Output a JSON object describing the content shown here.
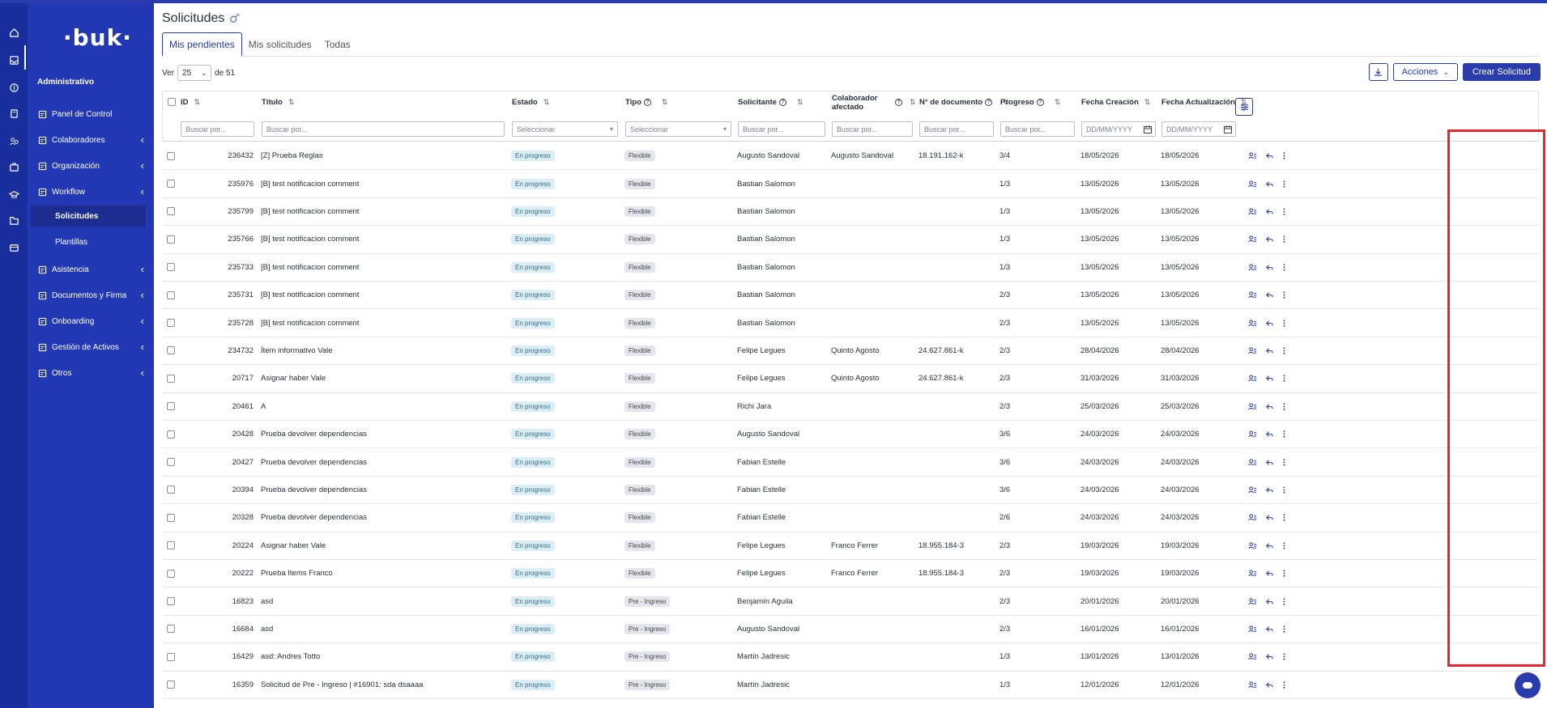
{
  "app": {
    "logo": "·buk·",
    "section_label": "Administrativo",
    "accent_color": "#2a3bab"
  },
  "rail_icons": [
    "home-icon",
    "inbox-icon",
    "money-icon",
    "calculator-icon",
    "people-icon",
    "briefcase-icon",
    "graduation-icon",
    "folder-icon",
    "card-icon"
  ],
  "sidebar": {
    "items": [
      {
        "label": "Panel de Control",
        "icon": "dashboard-icon",
        "chevron": false
      },
      {
        "label": "Colaboradores",
        "icon": "users-icon",
        "chevron": true
      },
      {
        "label": "Organización",
        "icon": "org-icon",
        "chevron": true
      },
      {
        "label": "Workflow",
        "icon": "workflow-icon",
        "chevron": true
      },
      {
        "label": "Asistencia",
        "icon": "calendar-icon",
        "chevron": true
      },
      {
        "label": "Documentos y Firma",
        "icon": "documents-icon",
        "chevron": true
      },
      {
        "label": "Onboarding",
        "icon": "onboarding-icon",
        "chevron": true
      },
      {
        "label": "Gestión de Activos",
        "icon": "assets-icon",
        "chevron": true
      },
      {
        "label": "Otros",
        "icon": "grid-icon",
        "chevron": true
      }
    ],
    "sub_items": [
      {
        "label": "Solicitudes",
        "active": true
      },
      {
        "label": "Plantillas",
        "active": false
      }
    ]
  },
  "page": {
    "title": "Solicitudes",
    "tabs": [
      {
        "label": "Mis pendientes",
        "active": true
      },
      {
        "label": "Mis solicitudes",
        "active": false
      },
      {
        "label": "Todas",
        "active": false
      }
    ],
    "ver_label": "Ver",
    "per_page": "25",
    "of_label": "de 51",
    "actions_label": "Acciones",
    "create_label": "Crear Solicitud"
  },
  "table": {
    "headers": {
      "id": "ID",
      "titulo": "Título",
      "estado": "Estado",
      "tipo": "Tipo",
      "solicitante": "Solicitante",
      "colaborador_1": "Colaborador",
      "colaborador_2": "afectado",
      "documento": "N° de documento",
      "progreso": "Progreso",
      "fecha_creacion": "Fecha Creación",
      "fecha_actualizacion": "Fecha Actualización"
    },
    "filters": {
      "buscar": "Buscar por...",
      "seleccionar": "Seleccionar",
      "fecha": "DD/MM/YYYY"
    },
    "rows": [
      {
        "id": "236432",
        "titulo": "[Z] Prueba Reglas",
        "estado": "En progreso",
        "tipo": "Flexible",
        "solicitante": "Augusto Sandoval",
        "colaborador": "Augusto Sandoval",
        "documento": "18.191.162-k",
        "progreso": "3/4",
        "creacion": "18/05/2026",
        "actualizacion": "18/05/2026"
      },
      {
        "id": "235976",
        "titulo": "[B] test notificacion comment",
        "estado": "En progreso",
        "tipo": "Flexible",
        "solicitante": "Bastian Salomon",
        "colaborador": "",
        "documento": "",
        "progreso": "1/3",
        "creacion": "13/05/2026",
        "actualizacion": "13/05/2026"
      },
      {
        "id": "235799",
        "titulo": "[B] test notificacion comment",
        "estado": "En progreso",
        "tipo": "Flexible",
        "solicitante": "Bastian Salomon",
        "colaborador": "",
        "documento": "",
        "progreso": "1/3",
        "creacion": "13/05/2026",
        "actualizacion": "13/05/2026"
      },
      {
        "id": "235766",
        "titulo": "[B] test notificacion comment",
        "estado": "En progreso",
        "tipo": "Flexible",
        "solicitante": "Bastian Salomon",
        "colaborador": "",
        "documento": "",
        "progreso": "1/3",
        "creacion": "13/05/2026",
        "actualizacion": "13/05/2026"
      },
      {
        "id": "235733",
        "titulo": "[B] test notificacion comment",
        "estado": "En progreso",
        "tipo": "Flexible",
        "solicitante": "Bastian Salomon",
        "colaborador": "",
        "documento": "",
        "progreso": "1/3",
        "creacion": "13/05/2026",
        "actualizacion": "13/05/2026"
      },
      {
        "id": "235731",
        "titulo": "[B] test notificacion comment",
        "estado": "En progreso",
        "tipo": "Flexible",
        "solicitante": "Bastian Salomon",
        "colaborador": "",
        "documento": "",
        "progreso": "2/3",
        "creacion": "13/05/2026",
        "actualizacion": "13/05/2026"
      },
      {
        "id": "235728",
        "titulo": "[B] test notificacion comment",
        "estado": "En progreso",
        "tipo": "Flexible",
        "solicitante": "Bastian Salomon",
        "colaborador": "",
        "documento": "",
        "progreso": "2/3",
        "creacion": "13/05/2026",
        "actualizacion": "13/05/2026"
      },
      {
        "id": "234732",
        "titulo": "Ítem informativo Vale",
        "estado": "En progreso",
        "tipo": "Flexible",
        "solicitante": "Felipe Legues",
        "colaborador": "Quinto Agosto",
        "documento": "24.627.861-k",
        "progreso": "2/3",
        "creacion": "28/04/2026",
        "actualizacion": "28/04/2026"
      },
      {
        "id": "20717",
        "titulo": "Asignar haber Vale",
        "estado": "En progreso",
        "tipo": "Flexible",
        "solicitante": "Felipe Legues",
        "colaborador": "Quinto Agosto",
        "documento": "24.627.861-k",
        "progreso": "2/3",
        "creacion": "31/03/2026",
        "actualizacion": "31/03/2026"
      },
      {
        "id": "20461",
        "titulo": "A",
        "estado": "En progreso",
        "tipo": "Flexible",
        "solicitante": "Richi Jara",
        "colaborador": "",
        "documento": "",
        "progreso": "2/3",
        "creacion": "25/03/2026",
        "actualizacion": "25/03/2026"
      },
      {
        "id": "20428",
        "titulo": "Prueba devolver dependencias",
        "estado": "En progreso",
        "tipo": "Flexible",
        "solicitante": "Augusto Sandoval",
        "colaborador": "",
        "documento": "",
        "progreso": "3/6",
        "creacion": "24/03/2026",
        "actualizacion": "24/03/2026"
      },
      {
        "id": "20427",
        "titulo": "Prueba devolver dependencias",
        "estado": "En progreso",
        "tipo": "Flexible",
        "solicitante": "Fabian Estelle",
        "colaborador": "",
        "documento": "",
        "progreso": "3/6",
        "creacion": "24/03/2026",
        "actualizacion": "24/03/2026"
      },
      {
        "id": "20394",
        "titulo": "Prueba devolver dependencias",
        "estado": "En progreso",
        "tipo": "Flexible",
        "solicitante": "Fabian Estelle",
        "colaborador": "",
        "documento": "",
        "progreso": "3/6",
        "creacion": "24/03/2026",
        "actualizacion": "24/03/2026"
      },
      {
        "id": "20328",
        "titulo": "Prueba devolver dependencias",
        "estado": "En progreso",
        "tipo": "Flexible",
        "solicitante": "Fabian Estelle",
        "colaborador": "",
        "documento": "",
        "progreso": "2/6",
        "creacion": "24/03/2026",
        "actualizacion": "24/03/2026"
      },
      {
        "id": "20224",
        "titulo": "Asignar haber Vale",
        "estado": "En progreso",
        "tipo": "Flexible",
        "solicitante": "Felipe Legues",
        "colaborador": "Franco Ferrer",
        "documento": "18.955.184-3",
        "progreso": "2/3",
        "creacion": "19/03/2026",
        "actualizacion": "19/03/2026"
      },
      {
        "id": "20222",
        "titulo": "Prueba Items Franco",
        "estado": "En progreso",
        "tipo": "Flexible",
        "solicitante": "Felipe Legues",
        "colaborador": "Franco Ferrer",
        "documento": "18.955.184-3",
        "progreso": "2/3",
        "creacion": "19/03/2026",
        "actualizacion": "19/03/2026"
      },
      {
        "id": "16823",
        "titulo": "asd",
        "estado": "En progreso",
        "tipo": "Pre - Ingreso",
        "solicitante": "Benjamín Aguila",
        "colaborador": "",
        "documento": "",
        "progreso": "2/3",
        "creacion": "20/01/2026",
        "actualizacion": "20/01/2026"
      },
      {
        "id": "16684",
        "titulo": "asd",
        "estado": "En progreso",
        "tipo": "Pre - Ingreso",
        "solicitante": "Augusto Sandoval",
        "colaborador": "",
        "documento": "",
        "progreso": "2/3",
        "creacion": "16/01/2026",
        "actualizacion": "16/01/2026"
      },
      {
        "id": "16429",
        "titulo": "asd: Andres Totto",
        "estado": "En progreso",
        "tipo": "Pre - Ingreso",
        "solicitante": "Martín Jadresic",
        "colaborador": "",
        "documento": "",
        "progreso": "1/3",
        "creacion": "13/01/2026",
        "actualizacion": "13/01/2026"
      },
      {
        "id": "16359",
        "titulo": "Solicitud de Pre - Ingreso | #16901: sda dsaaaa",
        "estado": "En progreso",
        "tipo": "Pre - Ingreso",
        "solicitante": "Martín Jadresic",
        "colaborador": "",
        "documento": "",
        "progreso": "1/3",
        "creacion": "12/01/2026",
        "actualizacion": "12/01/2026"
      }
    ]
  }
}
